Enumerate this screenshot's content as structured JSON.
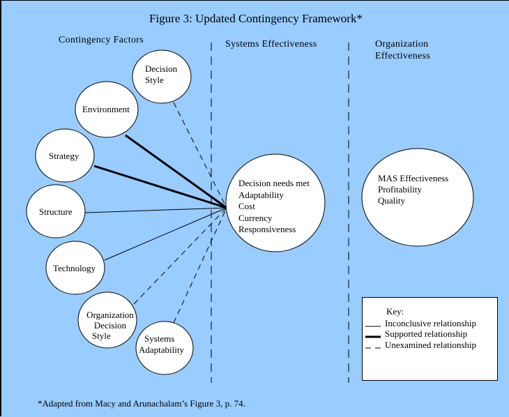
{
  "title": "Figure 3: Updated Contingency Framework*",
  "columns": {
    "contingency": "Contingency Factors",
    "systems": "Systems Effectiveness",
    "organization": [
      "Organization",
      "Effectiveness"
    ]
  },
  "factors": [
    {
      "id": "decision-style",
      "lines": [
        "Decision",
        "Style"
      ],
      "relationship": "unexamined"
    },
    {
      "id": "environment",
      "lines": [
        "Environment"
      ],
      "relationship": "supported"
    },
    {
      "id": "strategy",
      "lines": [
        "Strategy"
      ],
      "relationship": "supported"
    },
    {
      "id": "structure",
      "lines": [
        "Structure"
      ],
      "relationship": "inconclusive"
    },
    {
      "id": "technology",
      "lines": [
        "Technology"
      ],
      "relationship": "inconclusive"
    },
    {
      "id": "organization-decision-style",
      "lines": [
        "Organization",
        "Decision",
        "Style"
      ],
      "relationship": "unexamined"
    },
    {
      "id": "systems-adaptability",
      "lines": [
        "Systems",
        "Adaptability"
      ],
      "relationship": "unexamined"
    }
  ],
  "systems_effectiveness": [
    "Decision needs met",
    "Adaptability",
    "Cost",
    "Currency",
    "Responsiveness"
  ],
  "organization_effectiveness": [
    "MAS Effectiveness",
    "Profitability",
    "Quality"
  ],
  "key": {
    "heading": "Key:",
    "items": [
      {
        "style": "inconclusive",
        "label": "Inconclusive relationship"
      },
      {
        "style": "supported",
        "label": "Supported relationship"
      },
      {
        "style": "unexamined",
        "label": "Unexamined relationship"
      }
    ]
  },
  "footnote": "*Adapted from Macy and Arunachalam’s Figure 3, p. 74.",
  "colors": {
    "background": "#99ccff",
    "node_fill": "#ffffff",
    "line": "#000000"
  }
}
